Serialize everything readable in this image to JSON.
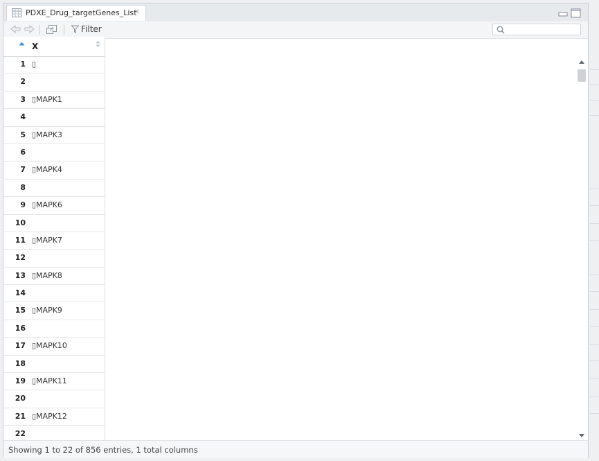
{
  "tab": {
    "title": "PDXE_Drug_targetGenes_List",
    "close": "×"
  },
  "toolbar": {
    "filter_label": "Filter",
    "search_placeholder": ""
  },
  "table": {
    "column_header": "X",
    "rows": [
      {
        "num": "1",
        "value": "▯"
      },
      {
        "num": "2",
        "value": ""
      },
      {
        "num": "3",
        "value": "▯MAPK1"
      },
      {
        "num": "4",
        "value": ""
      },
      {
        "num": "5",
        "value": "▯MAPK3"
      },
      {
        "num": "6",
        "value": ""
      },
      {
        "num": "7",
        "value": "▯MAPK4"
      },
      {
        "num": "8",
        "value": ""
      },
      {
        "num": "9",
        "value": "▯MAPK6"
      },
      {
        "num": "10",
        "value": ""
      },
      {
        "num": "11",
        "value": "▯MAPK7"
      },
      {
        "num": "12",
        "value": ""
      },
      {
        "num": "13",
        "value": "▯MAPK8"
      },
      {
        "num": "14",
        "value": ""
      },
      {
        "num": "15",
        "value": "▯MAPK9"
      },
      {
        "num": "16",
        "value": ""
      },
      {
        "num": "17",
        "value": "▯MAPK10"
      },
      {
        "num": "18",
        "value": ""
      },
      {
        "num": "19",
        "value": "▯MAPK11"
      },
      {
        "num": "20",
        "value": ""
      },
      {
        "num": "21",
        "value": "▯MAPK12"
      },
      {
        "num": "22",
        "value": ""
      }
    ]
  },
  "footer": {
    "status": "Showing 1 to 22 of 856 entries, 1 total columns"
  },
  "icons": {
    "tab": "table-icon",
    "close": "close-icon",
    "back": "back-arrow-icon",
    "forward": "forward-arrow-icon",
    "popout": "popout-icon",
    "filter": "filter-icon",
    "search": "search-icon",
    "minimize": "minimize-icon",
    "maximize": "maximize-icon"
  },
  "colors": {
    "sort_accent": "#3a8fd8"
  }
}
